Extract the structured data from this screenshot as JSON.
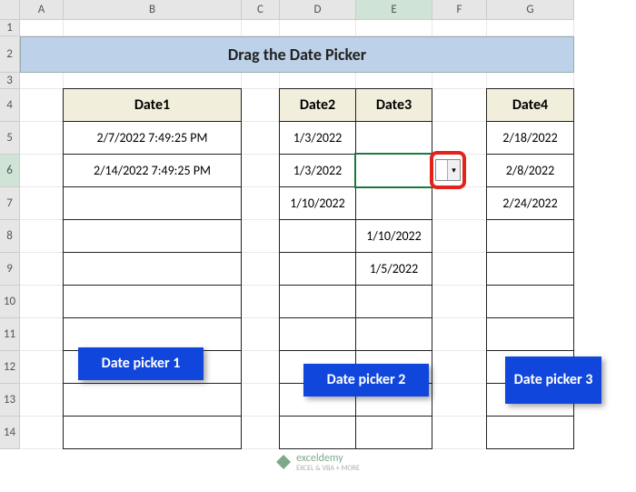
{
  "columnHeaders": [
    "A",
    "B",
    "C",
    "D",
    "E",
    "F",
    "G"
  ],
  "rowCount": 14,
  "selectedCol": "E",
  "selectedRow": 6,
  "banner": {
    "title": "Drag the Date Picker"
  },
  "table1": {
    "header": "Date1",
    "rows": [
      "2/7/2022  7:49:25 PM",
      "2/14/2022  7:49:25 PM",
      "",
      "",
      "",
      "",
      "",
      "",
      "",
      ""
    ]
  },
  "table2a": {
    "header": "Date2",
    "rows": [
      "1/3/2022",
      "1/3/2022",
      "1/10/2022",
      "",
      "",
      "",
      "",
      "",
      "",
      ""
    ]
  },
  "table2b": {
    "header": "Date3",
    "rows": [
      "",
      "",
      "",
      "1/10/2022",
      "1/5/2022",
      "",
      "",
      "",
      "",
      ""
    ]
  },
  "table3": {
    "header": "Date4",
    "rows": [
      "2/18/2022",
      "2/8/2022",
      "2/24/2022",
      "",
      "",
      "",
      "",
      "",
      "",
      ""
    ]
  },
  "callouts": {
    "c1": "Date picker 1",
    "c2": "Date picker 2",
    "c3": "Date picker 3"
  },
  "watermark": {
    "name": "exceldemy",
    "tagline": "EXCEL & VBA + MORE"
  }
}
